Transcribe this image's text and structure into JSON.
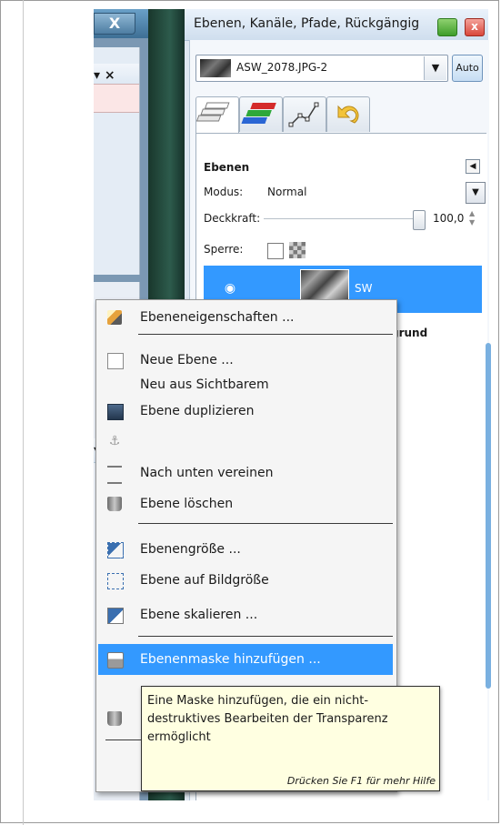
{
  "left_window": {
    "close_glyph": "X",
    "panel_close_glyph": "▾ ×"
  },
  "dock": {
    "title": "Ebenen, Kanäle, Pfade, Rückgängig",
    "image_selector": {
      "value": "ASW_2078.JPG-2"
    },
    "auto_label": "Auto",
    "tabs": [
      "layers-tab",
      "channels-tab",
      "paths-tab",
      "undo-tab"
    ]
  },
  "layers": {
    "header": "Ebenen",
    "mode_label": "Modus:",
    "mode_value": "Normal",
    "opacity_label": "Deckkraft:",
    "opacity_value": "100,0",
    "lock_label": "Sperre:",
    "rows": [
      {
        "name": "SW",
        "selected": true
      },
      {
        "name": "Hintergrund",
        "visible_text": "grund",
        "selected": false
      }
    ]
  },
  "context_menu": {
    "items": [
      {
        "label": "Ebeneneigenschaften ...",
        "icon": "pencil-icon"
      },
      {
        "label": "Neue Ebene ...",
        "icon": "page-icon"
      },
      {
        "label": "Neu aus Sichtbarem",
        "icon": ""
      },
      {
        "label": "Ebene duplizieren",
        "icon": "duplicate-icon"
      },
      {
        "label": "",
        "icon": "anchor-icon"
      },
      {
        "label": "Nach unten vereinen",
        "icon": "merge-down-icon"
      },
      {
        "label": "Ebene löschen",
        "icon": "trash-icon"
      },
      {
        "label": "Ebenengröße ...",
        "icon": "layer-size-icon"
      },
      {
        "label": "Ebene auf Bildgröße",
        "icon": "fit-image-icon"
      },
      {
        "label": "Ebene skalieren ...",
        "icon": "scale-icon"
      },
      {
        "label": "Ebenenmaske hinzufügen ...",
        "icon": "mask-icon",
        "highlighted": true
      },
      {
        "label": "",
        "icon": "trash-icon"
      }
    ]
  },
  "tooltip": {
    "lines": [
      "Eine Maske hinzufügen, die ein nicht-",
      "destruktives Bearbeiten der Transparenz",
      "ermöglicht"
    ],
    "hint": "Drücken Sie F1 für mehr Hilfe"
  },
  "colors": {
    "selection": "#3399ff",
    "tooltip_bg": "#ffffe1",
    "menu_bg": "#f5f5f5"
  }
}
